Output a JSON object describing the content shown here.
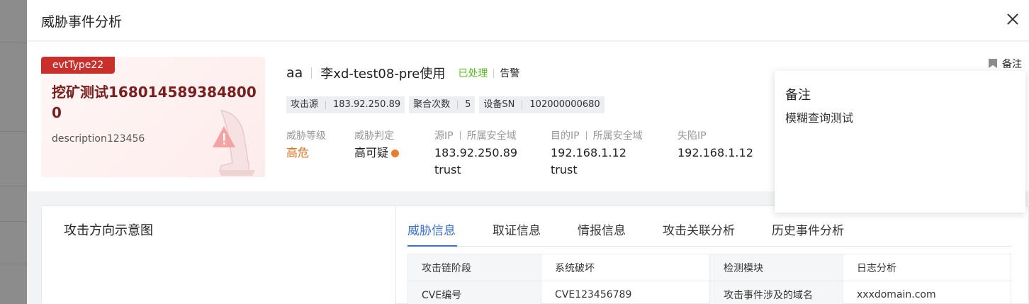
{
  "drawer": {
    "title": "威胁事件分析"
  },
  "event": {
    "tag": "evtType22",
    "name": "挖矿测试1680145893848000",
    "description": "description123456"
  },
  "title_row": {
    "name": "aa",
    "asset": "李xd-test08-pre使用",
    "status": "已处理",
    "type": "告警"
  },
  "chips": [
    {
      "label": "攻击源",
      "value": "183.92.250.89"
    },
    {
      "label": "聚合次数",
      "value": "5"
    },
    {
      "label": "设备SN",
      "value": "102000000680"
    }
  ],
  "fields": {
    "level": {
      "label": "威胁等级",
      "value": "高危"
    },
    "verdict": {
      "label": "威胁判定",
      "value": "高可疑"
    },
    "src": {
      "label_a": "源IP",
      "label_b": "所属安全域",
      "ip": "183.92.250.89",
      "domain": "trust"
    },
    "dst": {
      "label_a": "目的IP",
      "label_b": "所属安全域",
      "ip": "192.168.1.12",
      "domain": "trust"
    },
    "lost": {
      "label": "失陷IP",
      "ip": "192.168.1.12"
    }
  },
  "note": {
    "link_label": "备注",
    "popover_title": "备注",
    "popover_body": "模糊查询测试"
  },
  "panel": {
    "attack_direction_title": "攻击方向示意图",
    "tabs": [
      "威胁信息",
      "取证信息",
      "情报信息",
      "攻击关联分析",
      "历史事件分析"
    ],
    "active_tab": "威胁信息",
    "table": [
      [
        "攻击链阶段",
        "系统破坏",
        "检测模块",
        "日志分析"
      ],
      [
        "CVE编号",
        "CVE123456789",
        "攻击事件涉及的域名",
        "xxxdomain.com"
      ]
    ]
  },
  "colors": {
    "accent": "#3a6fd8",
    "danger": "#c9302c",
    "status_done": "#52c41a",
    "level_high": "#e8701a"
  }
}
